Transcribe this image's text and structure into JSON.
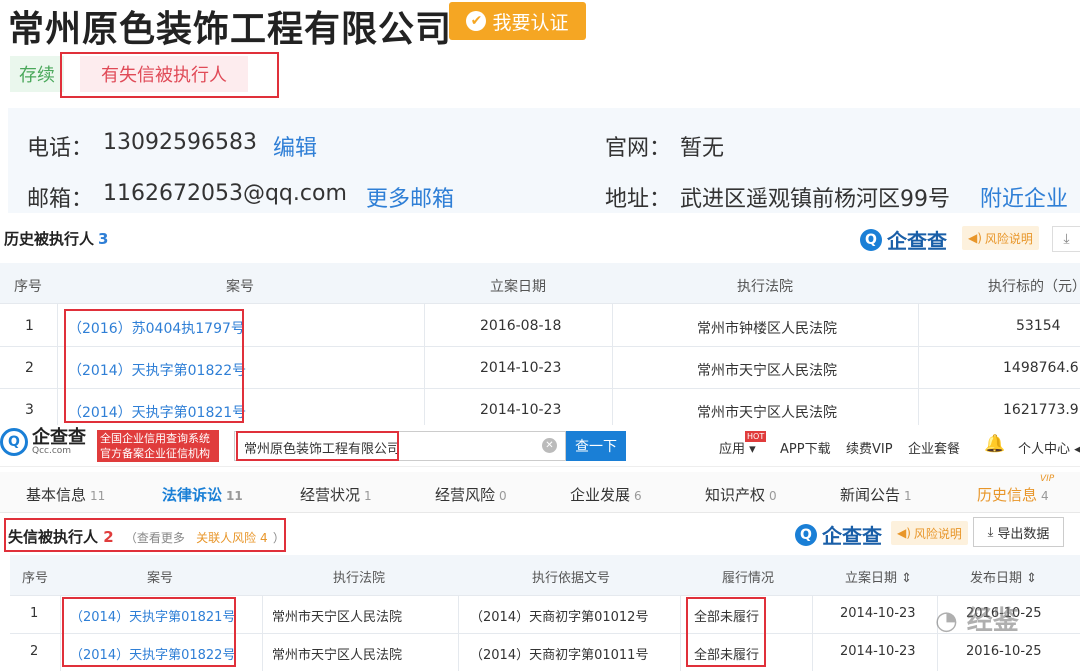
{
  "company": {
    "name": "常州原色装饰工程有限公司",
    "verify_label": "我要认证",
    "status_tag": "存续",
    "risk_tag": "有失信被执行人"
  },
  "contact": {
    "phone_label": "电话：",
    "phone": "13092596583",
    "edit_link": "编辑",
    "website_label": "官网：",
    "website": "暂无",
    "email_label": "邮箱：",
    "email": "1162672053@qq.com",
    "more_email_link": "更多邮箱",
    "address_label": "地址：",
    "address": "武进区遥观镇前杨河区99号",
    "nearby_link": "附近企业"
  },
  "history_executed": {
    "title": "历史被执行人",
    "count": "3",
    "brand": "企查查",
    "risk_label": "风险说明",
    "columns": [
      "序号",
      "案号",
      "立案日期",
      "执行法院",
      "执行标的（元）"
    ],
    "rows": [
      {
        "no": "1",
        "case": "（2016）苏0404执1797号",
        "date": "2016-08-18",
        "court": "常州市钟楼区人民法院",
        "amount": "53154"
      },
      {
        "no": "2",
        "case": "（2014）天执字第01822号",
        "date": "2014-10-23",
        "court": "常州市天宁区人民法院",
        "amount": "1498764.6"
      },
      {
        "no": "3",
        "case": "（2014）天执字第01821号",
        "date": "2014-10-23",
        "court": "常州市天宁区人民法院",
        "amount": "1621773.9"
      }
    ]
  },
  "site_header": {
    "brand": "企查查",
    "brand_sub": "Qcc.com",
    "badge_line1": "全国企业信用查询系统",
    "badge_line2": "官方备案企业征信机构",
    "search_value": "常州原色装饰工程有限公司",
    "search_button": "查一下",
    "nav": {
      "app_label": "应用",
      "hot": "HOT",
      "download": "APP下载",
      "vip": "续费VIP",
      "package": "企业套餐",
      "user": "个人中心"
    }
  },
  "tabs": [
    {
      "label": "基本信息",
      "count": "11"
    },
    {
      "label": "法律诉讼",
      "count": "11"
    },
    {
      "label": "经营状况",
      "count": "1"
    },
    {
      "label": "经营风险",
      "count": "0"
    },
    {
      "label": "企业发展",
      "count": "6"
    },
    {
      "label": "知识产权",
      "count": "0"
    },
    {
      "label": "新闻公告",
      "count": "1"
    },
    {
      "label": "历史信息",
      "count": "4"
    }
  ],
  "vip_mark": "VIP",
  "dishonest": {
    "title": "失信被执行人",
    "count": "2",
    "view_more": "（查看更多",
    "related_risk": "关联人风险 4",
    "close_paren": "）",
    "brand": "企查查",
    "risk_label": "风险说明",
    "export_label": "导出数据",
    "columns": [
      "序号",
      "案号",
      "执行法院",
      "执行依据文号",
      "履行情况",
      "立案日期 ⇕",
      "发布日期 ⇕"
    ],
    "rows": [
      {
        "no": "1",
        "case": "（2014）天执字第01821号",
        "court": "常州市天宁区人民法院",
        "basis": "（2014）天商初字第01012号",
        "status": "全部未履行",
        "filed": "2014-10-23",
        "published": "2016-10-25"
      },
      {
        "no": "2",
        "case": "（2014）天执字第01822号",
        "court": "常州市天宁区人民法院",
        "basis": "（2014）天商初字第01011号",
        "status": "全部未履行",
        "filed": "2014-10-23",
        "published": "2016-10-25"
      }
    ]
  },
  "watermark": "经鉴"
}
